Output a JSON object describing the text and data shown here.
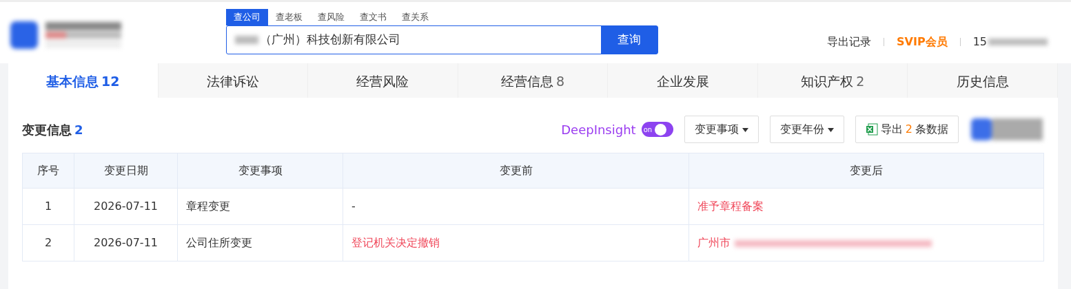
{
  "header": {
    "search_tabs": [
      {
        "label": "查公司",
        "selected": true
      },
      {
        "label": "查老板",
        "selected": false
      },
      {
        "label": "查风险",
        "selected": false
      },
      {
        "label": "查文书",
        "selected": false
      },
      {
        "label": "查关系",
        "selected": false
      }
    ],
    "search": {
      "value": "（广州）科技创新有限公司",
      "button": "查询"
    },
    "links": [
      {
        "label": "导出记录",
        "kind": "plain"
      },
      {
        "label": "SVIP会员",
        "kind": "vip"
      },
      {
        "label": "15",
        "kind": "account"
      }
    ]
  },
  "tabs": [
    {
      "label": "基本信息",
      "count": "12",
      "selected": true
    },
    {
      "label": "法律诉讼",
      "selected": false
    },
    {
      "label": "经营风险",
      "selected": false
    },
    {
      "label": "经营信息",
      "count": "8",
      "selected": false
    },
    {
      "label": "企业发展",
      "selected": false
    },
    {
      "label": "知识产权",
      "count": "2",
      "selected": false
    },
    {
      "label": "历史信息",
      "selected": false
    }
  ],
  "section": {
    "title": "变更信息",
    "count": "2",
    "deepinsight": {
      "label": "DeepInsight",
      "toggle_text": "on",
      "on": true
    },
    "filters": [
      "变更事项",
      "变更年份"
    ],
    "export": {
      "prefix": "导出",
      "count": "2",
      "suffix": "条数据"
    }
  },
  "table": {
    "columns": [
      "序号",
      "变更日期",
      "变更事项",
      "变更前",
      "变更后"
    ],
    "rows": [
      {
        "cells": [
          "1",
          "2026-07-11",
          "章程变更",
          "-",
          "准予章程备案"
        ],
        "highlight": [
          false,
          false,
          false,
          false,
          true
        ]
      },
      {
        "cells": [
          "2",
          "2026-07-11",
          "公司住所变更",
          "登记机关决定撤销",
          "广州市"
        ],
        "highlight": [
          false,
          false,
          false,
          true,
          true
        ]
      }
    ]
  }
}
